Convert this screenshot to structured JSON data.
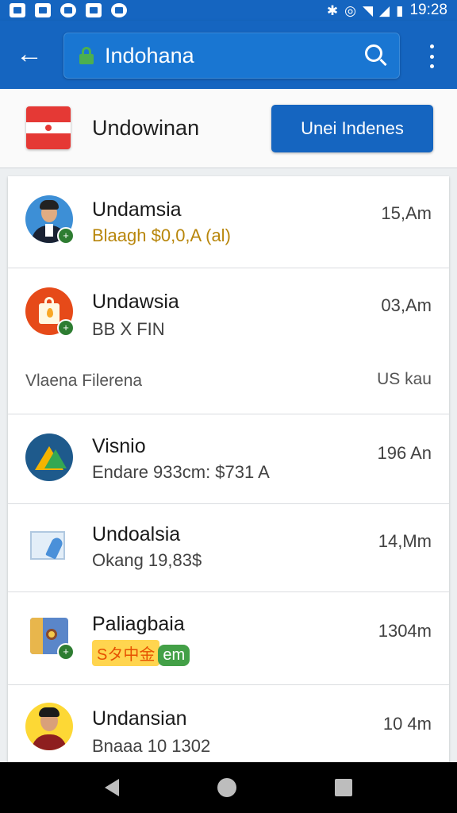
{
  "status_bar": {
    "time": "19:28",
    "icons": [
      "mail-icon",
      "image-icon",
      "app-icon",
      "photo-icon",
      "compass-icon",
      "bluetooth-icon",
      "alarm-icon",
      "wifi-icon",
      "signal-icon",
      "battery-icon"
    ]
  },
  "app_bar": {
    "search_value": "Indohana",
    "icons": [
      "back-arrow-icon",
      "lock-icon",
      "search-icon",
      "more-vert-icon"
    ]
  },
  "header": {
    "title": "Undowinan",
    "button_label": "Unei Indenes",
    "flag_colors": [
      "#e53935",
      "#ffffff"
    ]
  },
  "list": {
    "items": [
      {
        "title": "Undamsia",
        "subtitle": "Blaagh $0,0,A (al)",
        "time": "15,Am",
        "avatar": "person-suit-avatar",
        "subtitle_color": "#b8860b"
      },
      {
        "title": "Undawsia",
        "subtitle": "BB X FIN",
        "time": "03,Am",
        "avatar": "shopping-bag-avatar",
        "extra_left": "Vlaena Filerena",
        "extra_right": "US kau"
      },
      {
        "title": "Visnio",
        "subtitle": "Endare 933cm: $731 A",
        "time": "196 An",
        "avatar": "map-avatar"
      },
      {
        "title": "Undoalsia",
        "subtitle": "Okang 19,83$",
        "time": "14,Mm",
        "avatar": "envelope-pin-avatar"
      },
      {
        "title": "Paliagbaia",
        "subtitle_tag": "Sタ中金",
        "subtitle_tag2": "em",
        "time": "1304m",
        "avatar": "box-avatar"
      },
      {
        "title": "Undansian",
        "subtitle": "Bnaaa 10 1302",
        "time": "10 4m",
        "avatar": "person-yellow-avatar"
      }
    ]
  },
  "nav_bar": {
    "icons": [
      "nav-back-icon",
      "nav-home-icon",
      "nav-recents-icon"
    ]
  },
  "colors": {
    "primary": "#1565c0",
    "accent_green": "#43a047",
    "background": "#eceff1"
  }
}
